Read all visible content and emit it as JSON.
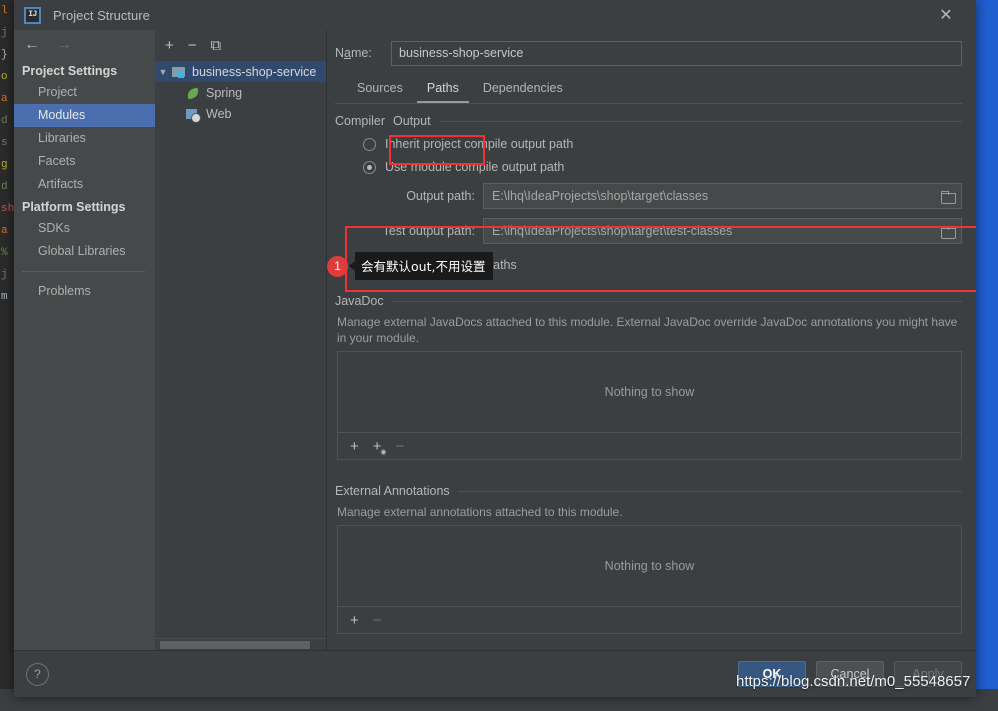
{
  "window": {
    "title": "Project Structure",
    "app_icon": "intellij-idea-icon",
    "close_icon": "✕"
  },
  "nav": {
    "back_icon": "←",
    "forward_icon": "→",
    "groups": [
      {
        "title": "Project Settings",
        "items": [
          {
            "label": "Project",
            "selected": false
          },
          {
            "label": "Modules",
            "selected": true
          },
          {
            "label": "Libraries",
            "selected": false
          },
          {
            "label": "Facets",
            "selected": false
          },
          {
            "label": "Artifacts",
            "selected": false
          }
        ]
      },
      {
        "title": "Platform Settings",
        "items": [
          {
            "label": "SDKs",
            "selected": false
          },
          {
            "label": "Global Libraries",
            "selected": false
          }
        ]
      }
    ],
    "extra_items": [
      {
        "label": "Problems",
        "selected": false
      }
    ]
  },
  "tree": {
    "toolbar": {
      "add": "+",
      "remove": "−",
      "copy": "⧉"
    },
    "nodes": [
      {
        "label": "business-shop-service",
        "icon": "module-icon",
        "depth": 0,
        "expanded": true,
        "selected": true
      },
      {
        "label": "Spring",
        "icon": "spring-icon",
        "depth": 1,
        "expanded": false,
        "selected": false
      },
      {
        "label": "Web",
        "icon": "web-icon",
        "depth": 1,
        "expanded": false,
        "selected": false
      }
    ]
  },
  "module": {
    "name_label": "Name:",
    "name_value": "business-shop-service",
    "tabs": [
      {
        "label": "Sources",
        "active": false
      },
      {
        "label": "Paths",
        "active": true
      },
      {
        "label": "Dependencies",
        "active": false
      }
    ],
    "compiler_output": {
      "section_label_prefix": "Compiler",
      "section_label_highlight": "Output",
      "options": [
        {
          "label": "Inherit project compile output path",
          "checked": false
        },
        {
          "label": "Use module compile output path",
          "checked": true
        }
      ],
      "output_path_label": "Output path:",
      "output_path_value": "E:\\lhq\\IdeaProjects\\shop\\target\\classes",
      "test_output_path_label": "Test output path:",
      "test_output_path_value": "E:\\lhq\\IdeaProjects\\shop\\target\\test-classes",
      "browse_icon": "folder-icon",
      "exclude_label": "Exclude output paths",
      "exclude_checked": false
    },
    "javadoc": {
      "section_label": "JavaDoc",
      "description": "Manage external JavaDocs attached to this module. External JavaDoc override JavaDoc annotations you might have in your module.",
      "empty_text": "Nothing to show",
      "toolbar": {
        "add": "+",
        "add_special": "+",
        "remove": "−"
      }
    },
    "external_annotations": {
      "section_label": "External Annotations",
      "description": "Manage external annotations attached to this module.",
      "empty_text": "Nothing to show",
      "toolbar": {
        "add": "+",
        "remove": "−"
      }
    }
  },
  "annotation": {
    "badge": "1",
    "text": "会有默认out,不用设置",
    "highlight_color": "#f03232",
    "badge_color": "#e23b3b"
  },
  "footer": {
    "help_icon": "?",
    "ok_label": "OK",
    "cancel_label": "Cancel",
    "apply_label": "Apply"
  },
  "watermark": {
    "text": "https://blog.csdn.net/m0_55548657"
  },
  "background": {
    "code_fragments": [
      "l",
      "j",
      "}",
      "o",
      "a",
      "d",
      "s",
      "g",
      "d",
      "sh",
      "a",
      "%",
      "j",
      "m"
    ],
    "right_strip_color": "#1f5fd0"
  }
}
